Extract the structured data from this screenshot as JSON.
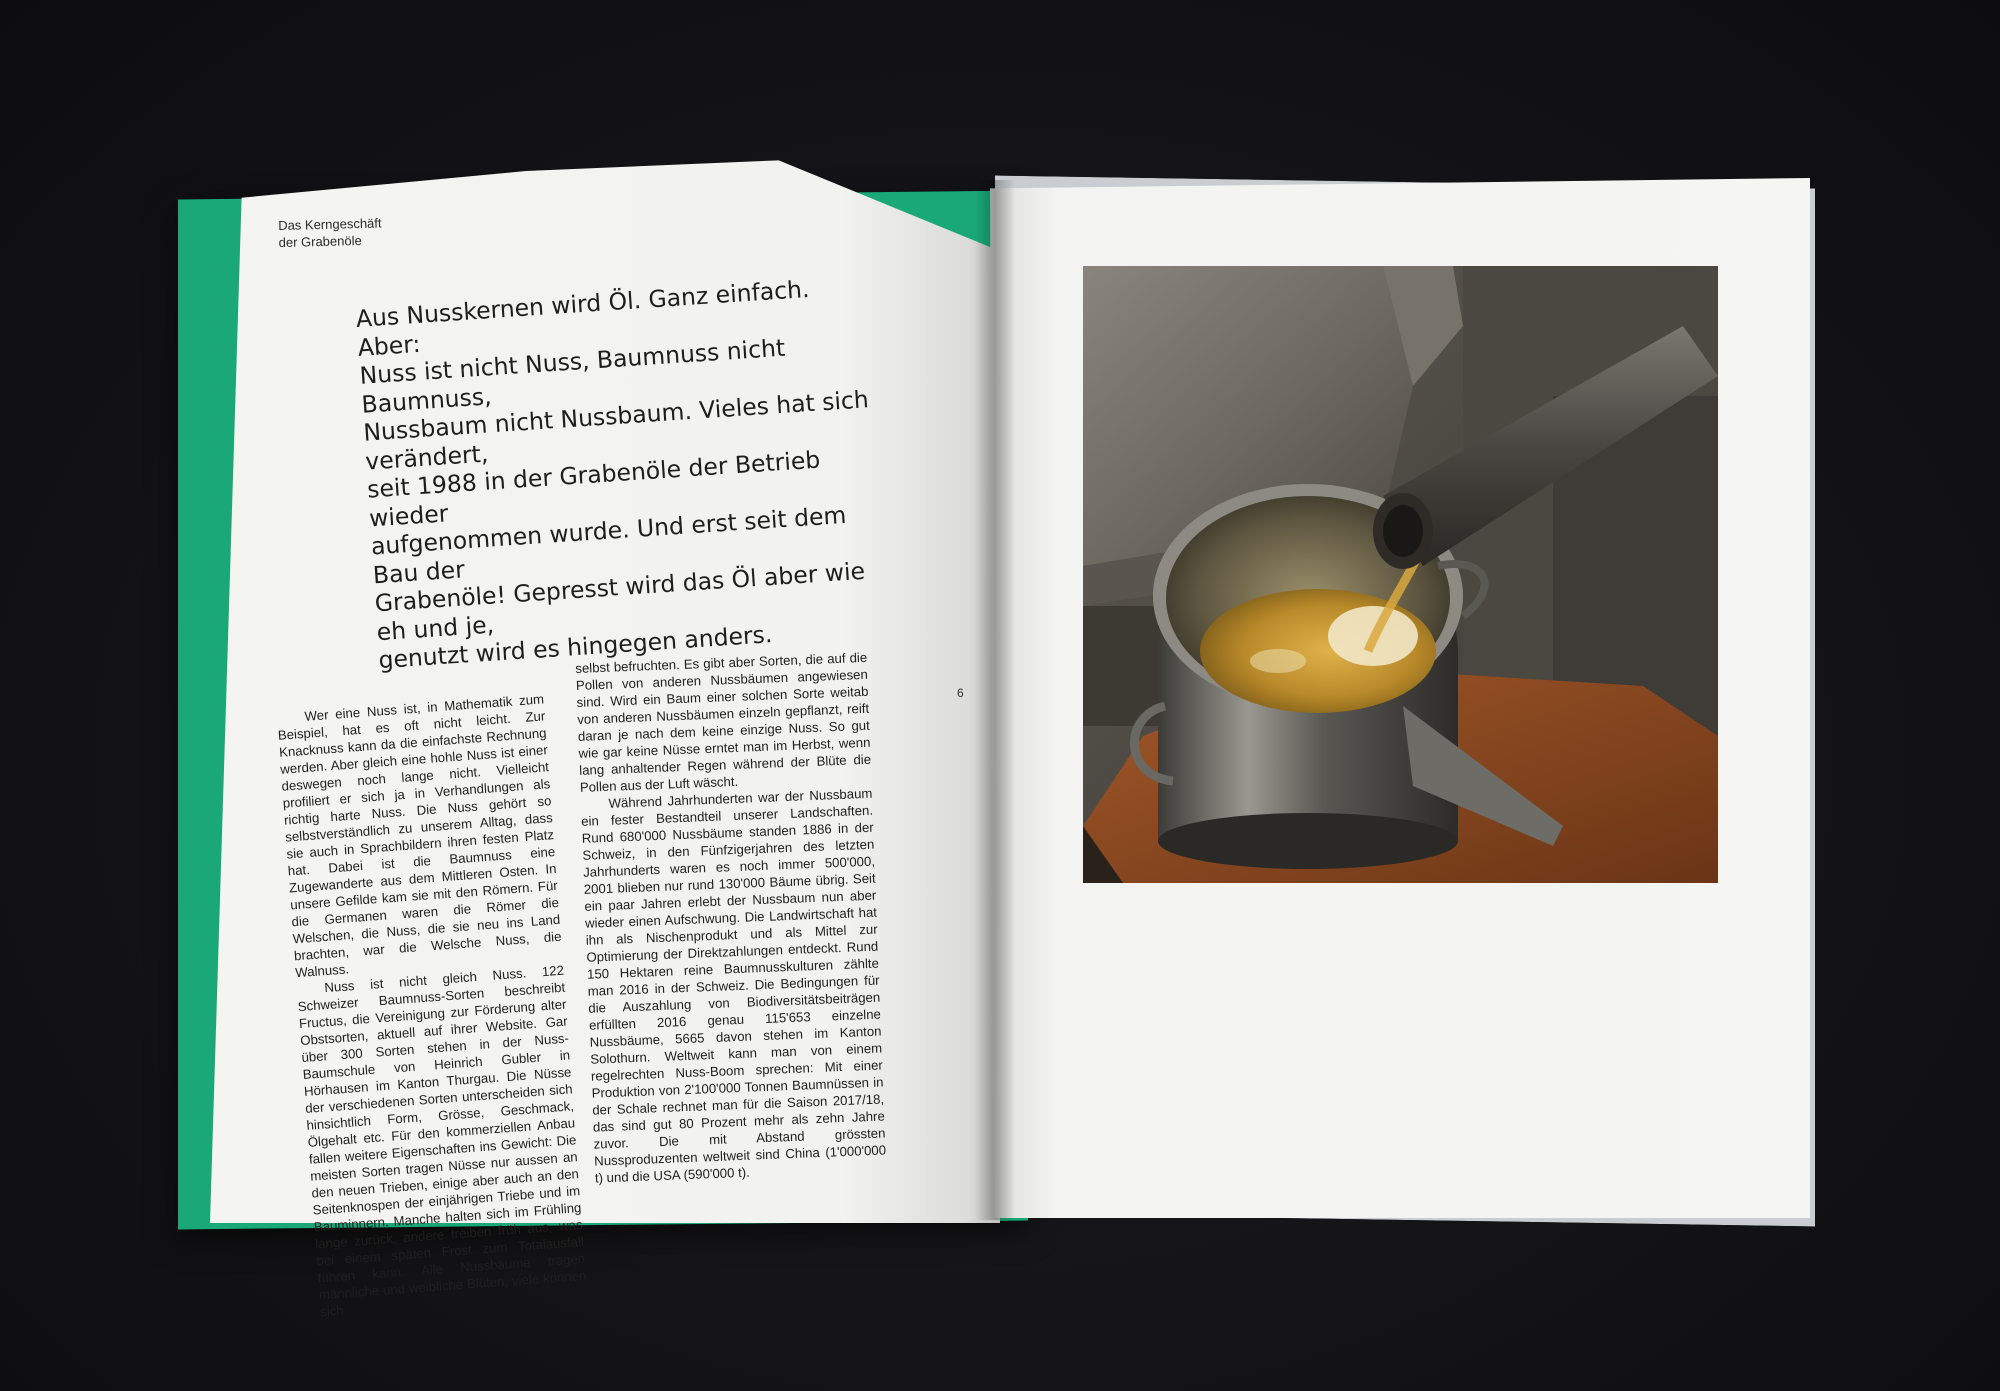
{
  "running_head": {
    "line1": "Das Kerngeschäft",
    "line2": "der Grabenöle"
  },
  "intro_lines": [
    "Aus Nusskernen wird Öl. Ganz einfach. Aber:",
    "Nuss ist nicht Nuss, Baumnuss nicht Baumnuss,",
    "Nussbaum nicht Nussbaum. Vieles hat sich verändert,",
    "seit 1988 in der Grabenöle der Betrieb wieder",
    "aufgenommen wurde. Und erst seit dem Bau der",
    "Grabenöle! Gepresst wird das Öl aber wie eh und je,",
    "genutzt wird es hingegen anders."
  ],
  "column_1": {
    "para_1": "Wer eine Nuss ist, in Mathematik zum Beispiel, hat es oft nicht leicht. Zur Knacknuss kann da die einfachste Rechnung werden. Aber gleich eine hohle Nuss ist einer deswegen noch lange nicht. Vielleicht profiliert er sich ja in Verhandlungen als richtig harte Nuss. Die Nuss gehört so selbstverständlich zu unserem Alltag, dass sie auch in Sprachbildern ihren festen Platz hat. Dabei ist die Baumnuss eine Zugewanderte aus dem Mittleren Osten. In unsere Gefilde kam sie mit den Römern. Für die Germanen waren die Römer die Welschen, die Nuss, die sie neu ins Land brachten, war die Welsche Nuss, die Walnuss.",
    "para_2": "Nuss ist nicht gleich Nuss. 122 Schweizer Baumnuss-Sorten beschreibt Fructus, die Vereinigung zur Förderung alter Obstsorten, aktuell auf ihrer Website. Gar über 300 Sorten stehen in der Nuss-Baumschule von Heinrich Gubler in Hörhausen im Kanton Thurgau. Die Nüsse der verschiedenen Sorten unterscheiden sich hinsichtlich Form, Grösse, Geschmack, Ölgehalt etc. Für den kommerziellen Anbau fallen weitere Eigenschaften ins Gewicht: Die meisten Sorten tragen Nüsse nur aussen an den neuen Trieben, einige aber auch an den Seitenknospen der einjährigen Triebe und im Bauminnern. Manche halten sich im Frühling lange zurück, andere treiben früh aus, was bei einem späten Frost zum Totalausfall führen kann. Alle Nussbäume tragen männliche und weibliche Blüten, viele können sich"
  },
  "column_2": {
    "para_1": "selbst befruchten. Es gibt aber Sorten, die auf die Pollen von anderen Nussbäumen angewiesen sind. Wird ein Baum einer solchen Sorte weitab von anderen Nussbäumen einzeln gepflanzt, reift daran je nach dem keine einzige Nuss. So gut wie gar keine Nüsse erntet man im Herbst, wenn lang anhaltender Regen während der Blüte die Pollen aus der Luft wäscht.",
    "para_2": "Während Jahrhunderten war der Nussbaum ein fester Bestandteil unserer Landschaften. Rund 680'000 Nussbäume standen 1886 in der Schweiz, in den Fünfzigerjahren des letzten Jahrhunderts waren es noch immer 500'000, 2001 blieben nur rund 130'000 Bäume übrig. Seit ein paar Jahren erlebt der Nussbaum nun aber wieder einen Aufschwung. Die Landwirtschaft hat ihn als Nischenprodukt und als Mittel zur Optimierung der Direktzahlungen entdeckt. Rund 150 Hektaren reine Baumnusskulturen zählte man 2016 in der Schweiz. Die Bedingungen für die Auszahlung von Biodiversitätsbeiträgen erfüllten 2016 genau 115'653 einzelne Nussbäume, 5665 davon stehen im Kanton Solothurn. Weltweit kann man von einem regelrechten Nuss-Boom sprechen: Mit einer Produktion von 2'100'000 Tonnen Baumnüssen in der Schale rechnet man für die Saison 2017/18, das sind gut 80 Prozent mehr als zehn Jahre zuvor. Die mit Abstand grössten Nussproduzenten weltweit sind China (1'000'000 t) und die USA (590'000 t)."
  },
  "page_number": "6",
  "colors": {
    "background": "#121214",
    "cover_green": "#1aa878",
    "paper": "#f4f4f2",
    "text": "#1e1e1e"
  }
}
